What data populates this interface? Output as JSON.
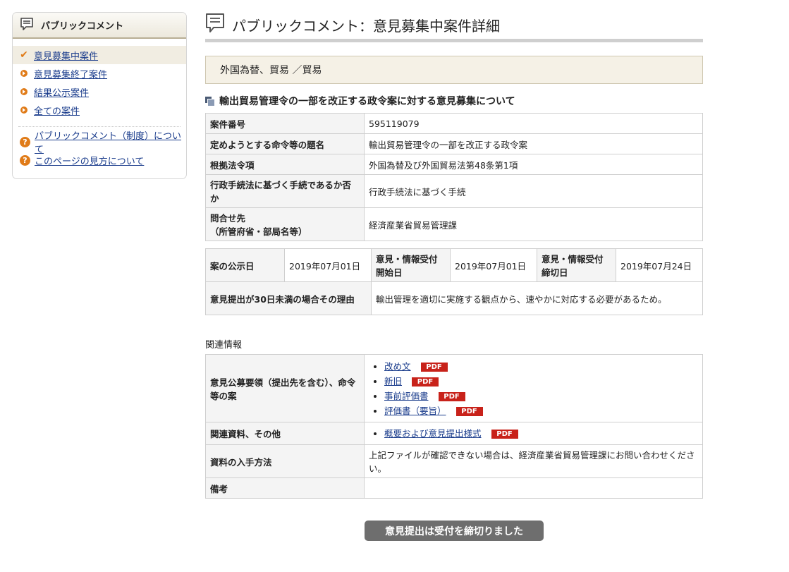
{
  "sidebar": {
    "title": "パブリックコメント",
    "items": [
      {
        "label": "意見募集中案件",
        "active": true
      },
      {
        "label": "意見募集終了案件",
        "active": false
      },
      {
        "label": "結果公示案件",
        "active": false
      },
      {
        "label": "全ての案件",
        "active": false
      }
    ],
    "help": [
      {
        "label": "パブリックコメント（制度）について"
      },
      {
        "label": "このページの見方について"
      }
    ]
  },
  "main": {
    "title": "パブリックコメント：意見募集中案件詳細",
    "category": "外国為替、貿易 ／貿易",
    "subject": "輸出貿易管理令の一部を改正する政令案に対する意見募集について",
    "info": {
      "case_no_label": "案件番号",
      "case_no": "595119079",
      "name_label": "定めようとする命令等の題名",
      "name": "輸出貿易管理令の一部を改正する政令案",
      "law_label": "根拠法令項",
      "law": "外国為替及び外国貿易法第48条第1項",
      "proc_label": "行政手続法に基づく手続であるか否か",
      "proc": "行政手続法に基づく手続",
      "contact_label_1": "問合せ先",
      "contact_label_2": "（所管府省・部局名等）",
      "contact": "経済産業省貿易管理課"
    },
    "dates": {
      "pub_label": "案の公示日",
      "pub": "2019年07月01日",
      "start_label_1": "意見・情報受付",
      "start_label_2": "開始日",
      "start": "2019年07月01日",
      "end_label_1": "意見・情報受付",
      "end_label_2": "締切日",
      "end": "2019年07月24日",
      "reason_label": "意見提出が30日未満の場合その理由",
      "reason": "輸出管理を適切に実施する観点から、速やかに対応する必要があるため。"
    },
    "related": {
      "heading": "関連情報",
      "docs_label": "意見公募要領（提出先を含む）、命令等の案",
      "docs": [
        "改め文",
        "新旧",
        "事前評価書",
        "評価書（要旨）"
      ],
      "other_label": "関連資料、その他",
      "other": [
        "概要および意見提出様式"
      ],
      "pdf": "PDF",
      "obtain_label": "資料の入手方法",
      "obtain": "上記ファイルが確認できない場合は、経済産業省貿易管理課にお問い合わせください。",
      "remarks_label": "備考",
      "remarks": ""
    },
    "closed_button": "意見提出は受付を締切りました"
  },
  "colors": {
    "accent": "#e07b18",
    "pdf_badge": "#c8221a",
    "button": "#6e6e6e",
    "category_bg": "#f5f1e6"
  }
}
